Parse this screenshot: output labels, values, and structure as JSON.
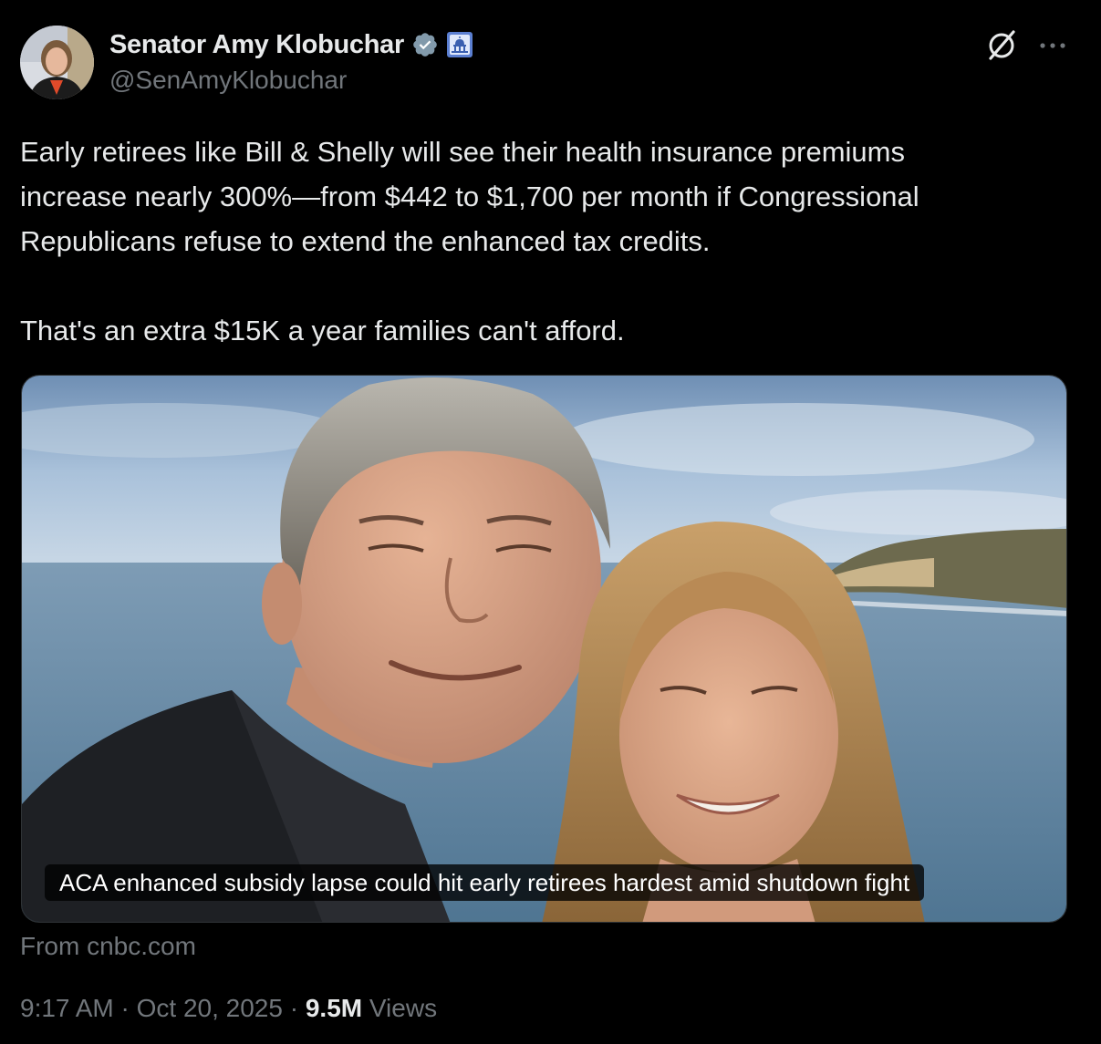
{
  "author": {
    "name": "Senator Amy Klobuchar",
    "handle": "@SenAmyKlobuchar",
    "verified_icon": "verified-badge-icon",
    "affiliation_icon": "government-capitol-icon",
    "avatar": "avatar-photo"
  },
  "header_actions": {
    "grok_icon": "grok-icon",
    "more_icon": "more-options-icon"
  },
  "tweet": {
    "lines": [
      "Early retirees like Bill & Shelly will see their health insurance premiums",
      "increase nearly 300%—from $442 to $1,700 per month if Congressional",
      "Republicans refuse to extend the enhanced tax credits."
    ],
    "second_paragraph": "That's an extra $15K a year families can't afford."
  },
  "media": {
    "caption": "ACA enhanced subsidy lapse could hit early retirees hardest amid shutdown fight",
    "source": "From cnbc.com"
  },
  "meta": {
    "time": "9:17 AM",
    "separator": "·",
    "date": "Oct 20, 2025",
    "views_count": "9.5M",
    "views_label": "Views"
  },
  "colors": {
    "background": "#000000",
    "primary_text": "#e7e9ea",
    "secondary_text": "#71767b",
    "verified_badge": "#829aab",
    "affiliation_badge": "#5b7fd1"
  }
}
